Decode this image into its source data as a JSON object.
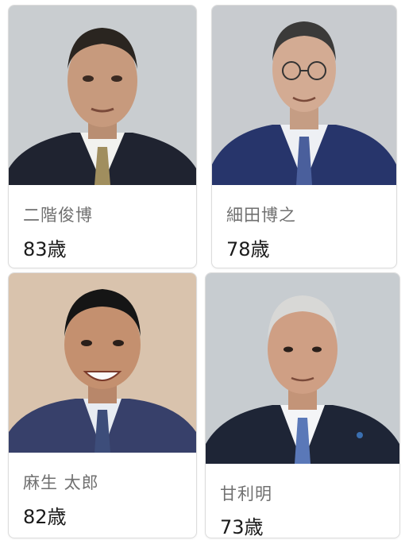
{
  "people": [
    {
      "name": "二階俊博",
      "age": "83歳",
      "photo_icon": "portrait-photo",
      "background": "#c9cdd0"
    },
    {
      "name": "細田博之",
      "age": "78歳",
      "photo_icon": "portrait-photo",
      "background": "#c8cbcf"
    },
    {
      "name": "麻生 太郎",
      "age": "82歳",
      "photo_icon": "portrait-photo",
      "background": "#d9c3ad"
    },
    {
      "name": "甘利明",
      "age": "73歳",
      "photo_icon": "portrait-photo",
      "background": "#c7ccd0"
    }
  ]
}
